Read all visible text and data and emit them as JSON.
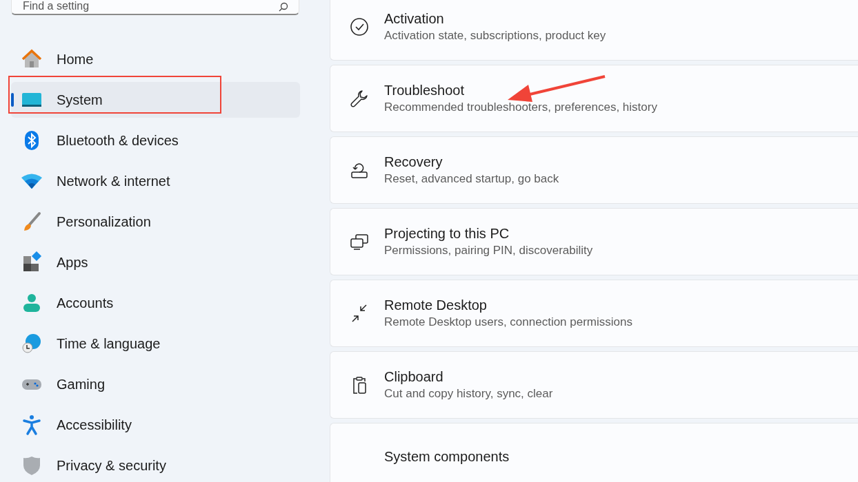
{
  "search": {
    "placeholder": "Find a setting"
  },
  "sidebar": {
    "items": [
      {
        "kind": "home",
        "label": "Home",
        "selected": false
      },
      {
        "kind": "system",
        "label": "System",
        "selected": true
      },
      {
        "kind": "bluetooth",
        "label": "Bluetooth & devices",
        "selected": false
      },
      {
        "kind": "network",
        "label": "Network & internet",
        "selected": false
      },
      {
        "kind": "brush",
        "label": "Personalization",
        "selected": false
      },
      {
        "kind": "apps",
        "label": "Apps",
        "selected": false
      },
      {
        "kind": "accounts",
        "label": "Accounts",
        "selected": false
      },
      {
        "kind": "time",
        "label": "Time & language",
        "selected": false
      },
      {
        "kind": "gaming",
        "label": "Gaming",
        "selected": false
      },
      {
        "kind": "accessibility",
        "label": "Accessibility",
        "selected": false
      },
      {
        "kind": "privacy",
        "label": "Privacy & security",
        "selected": false
      }
    ]
  },
  "settings": [
    {
      "kind": "check",
      "title": "Activation",
      "subtitle": "Activation state, subscriptions, product key"
    },
    {
      "kind": "wrench",
      "title": "Troubleshoot",
      "subtitle": "Recommended troubleshooters, preferences, history"
    },
    {
      "kind": "recovery",
      "title": "Recovery",
      "subtitle": "Reset, advanced startup, go back"
    },
    {
      "kind": "project",
      "title": "Projecting to this PC",
      "subtitle": "Permissions, pairing PIN, discoverability"
    },
    {
      "kind": "remote",
      "title": "Remote Desktop",
      "subtitle": "Remote Desktop users, connection permissions"
    },
    {
      "kind": "clipboard",
      "title": "Clipboard",
      "subtitle": "Cut and copy history, sync, clear"
    },
    {
      "kind": "none",
      "title": "System components"
    }
  ]
}
